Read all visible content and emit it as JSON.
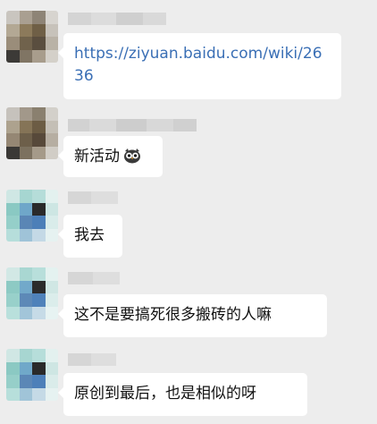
{
  "messages": [
    {
      "type": "link",
      "text": "https://ziyuan.baidu.com/wiki/2636"
    },
    {
      "type": "text",
      "text": "新活动",
      "emoji": "owl-emoji"
    },
    {
      "type": "text",
      "text": "我去"
    },
    {
      "type": "text",
      "text": "这不是要搞死很多搬砖的人嘛"
    },
    {
      "type": "text",
      "text": "原创到最后，也是相似的呀"
    }
  ],
  "colors": {
    "background": "#ededed",
    "bubble": "#ffffff",
    "link": "#3a6fb5",
    "text": "#111111"
  }
}
